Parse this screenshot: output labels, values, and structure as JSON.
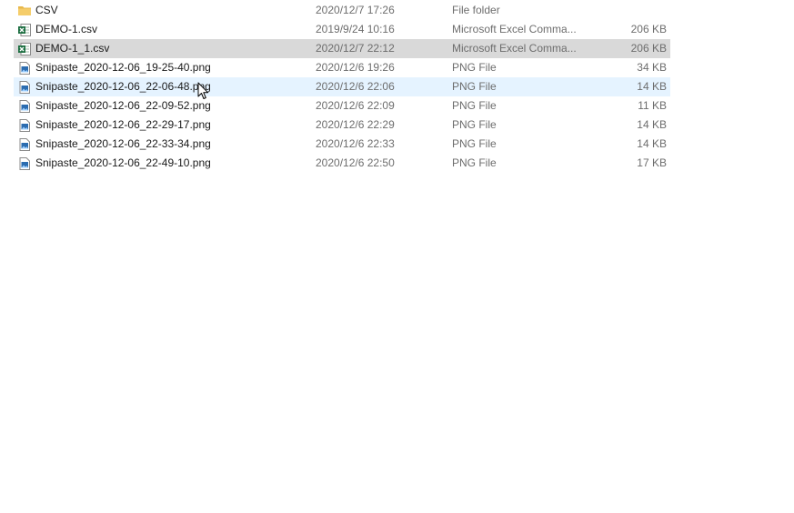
{
  "files": [
    {
      "name": "CSV",
      "date": "2020/12/7 17:26",
      "type": "File folder",
      "size": "",
      "icon": "folder-icon",
      "state": "normal"
    },
    {
      "name": "DEMO-1.csv",
      "date": "2019/9/24 10:16",
      "type": "Microsoft Excel Comma...",
      "size": "206 KB",
      "icon": "excel-csv-icon",
      "state": "normal"
    },
    {
      "name": "DEMO-1_1.csv",
      "date": "2020/12/7 22:12",
      "type": "Microsoft Excel Comma...",
      "size": "206 KB",
      "icon": "excel-csv-icon",
      "state": "selected"
    },
    {
      "name": "Snipaste_2020-12-06_19-25-40.png",
      "date": "2020/12/6 19:26",
      "type": "PNG File",
      "size": "34 KB",
      "icon": "image-file-icon",
      "state": "normal"
    },
    {
      "name": "Snipaste_2020-12-06_22-06-48.png",
      "date": "2020/12/6 22:06",
      "type": "PNG File",
      "size": "14 KB",
      "icon": "image-file-icon",
      "state": "hovered"
    },
    {
      "name": "Snipaste_2020-12-06_22-09-52.png",
      "date": "2020/12/6 22:09",
      "type": "PNG File",
      "size": "11 KB",
      "icon": "image-file-icon",
      "state": "normal"
    },
    {
      "name": "Snipaste_2020-12-06_22-29-17.png",
      "date": "2020/12/6 22:29",
      "type": "PNG File",
      "size": "14 KB",
      "icon": "image-file-icon",
      "state": "normal"
    },
    {
      "name": "Snipaste_2020-12-06_22-33-34.png",
      "date": "2020/12/6 22:33",
      "type": "PNG File",
      "size": "14 KB",
      "icon": "image-file-icon",
      "state": "normal"
    },
    {
      "name": "Snipaste_2020-12-06_22-49-10.png",
      "date": "2020/12/6 22:50",
      "type": "PNG File",
      "size": "17 KB",
      "icon": "image-file-icon",
      "state": "normal"
    }
  ],
  "colors": {
    "selected_row": "#d9d9d9",
    "hover_row": "#e5f3ff",
    "folder": "#e8b84a",
    "excel": "#1d6f42",
    "image": "#2b6cb0"
  }
}
